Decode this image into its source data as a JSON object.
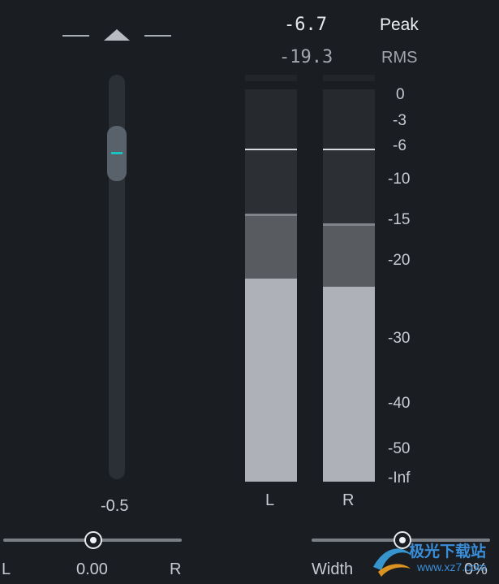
{
  "fader": {
    "up_icon": "triangle-up-icon",
    "value": "-0.5"
  },
  "readout": {
    "peak_value": "-6.7",
    "peak_label": "Peak",
    "rms_value": "-19.3",
    "rms_label": "RMS"
  },
  "meters": {
    "channels": [
      {
        "label": "L",
        "peak_hold_db": -6.7,
        "level_db": -20
      },
      {
        "label": "R",
        "peak_hold_db": -6.7,
        "level_db": -21
      }
    ],
    "scale": [
      "0",
      "-3",
      "-6",
      "-10",
      "-15",
      "-20",
      "-30",
      "-40",
      "-50",
      "-Inf"
    ]
  },
  "pan": {
    "left_label": "L",
    "value": "0.00",
    "right_label": "R"
  },
  "width": {
    "label": "Width",
    "value": "0%"
  },
  "watermark": {
    "text": "极光下载站",
    "url": "www.xz7.com"
  },
  "colors": {
    "background": "#1a1d22",
    "accent": "#19c2c2"
  }
}
